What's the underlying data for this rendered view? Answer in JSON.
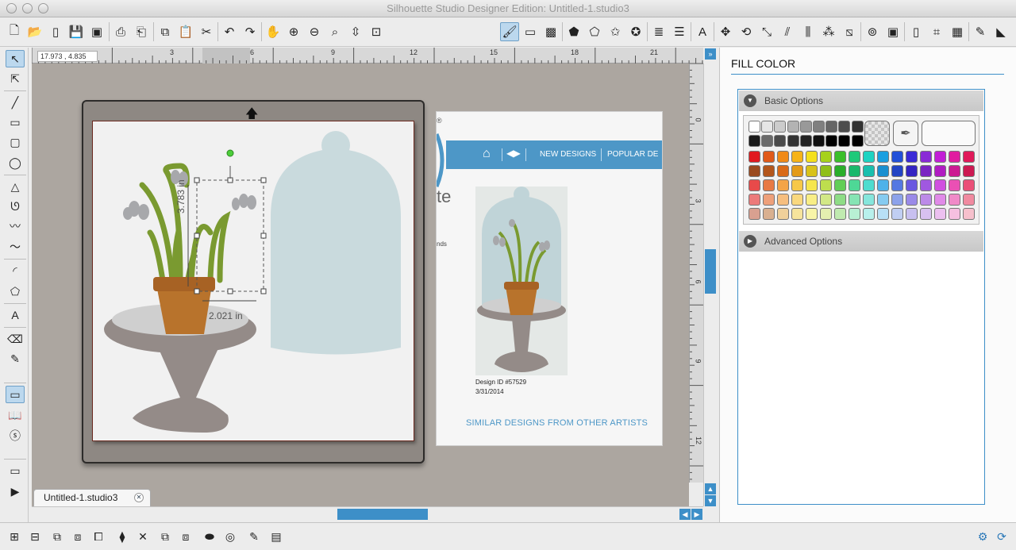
{
  "window": {
    "title": "Silhouette Studio Designer Edition: Untitled-1.studio3"
  },
  "ruler": {
    "coordinates": "17.973 , 4.835",
    "h_numbers": [
      "3",
      "6",
      "9",
      "12",
      "15",
      "18",
      "21"
    ],
    "v_numbers": [
      "0",
      "3",
      "6",
      "9",
      "12"
    ]
  },
  "canvas": {
    "dimensions": {
      "height": "3.783 in",
      "width": "2.021 in"
    }
  },
  "web_preview": {
    "reg_mark": "®",
    "title_fragment": "te",
    "fragment2": "nds",
    "nav_links": [
      "NEW DESIGNS",
      "POPULAR DE"
    ],
    "design_id": "Design ID #57529",
    "date": "3/31/2014",
    "similar": "SIMILAR DESIGNS FROM OTHER ARTISTS"
  },
  "doc_tab": {
    "name": "Untitled-1.studio3"
  },
  "panel": {
    "title": "FILL COLOR",
    "basic_options": "Basic Options",
    "advanced_options": "Advanced Options",
    "gray_row1": [
      "#ffffff",
      "#e6e6e6",
      "#cccccc",
      "#b3b3b3",
      "#999999",
      "#808080",
      "#666666",
      "#4d4d4d",
      "#333333"
    ],
    "gray_row2": [
      "#1a1a1a",
      "#6b6b6b",
      "#4a4a4a",
      "#333333",
      "#222222",
      "#111111",
      "#000000",
      "#000000",
      "#000000"
    ],
    "color_rows": [
      [
        "#e0191e",
        "#e05a1a",
        "#f08a18",
        "#f6b318",
        "#f4e01c",
        "#a6d21c",
        "#3bbf2a",
        "#1fc97a",
        "#1fd3c2",
        "#1a9fe0",
        "#2250d8",
        "#3a2ad6",
        "#8a2ad6",
        "#c21ed6",
        "#e01ca0",
        "#e01a5a"
      ],
      [
        "#9a4a1e",
        "#b3561c",
        "#d96a18",
        "#e39a18",
        "#d8c21a",
        "#8fbf1a",
        "#2aae2a",
        "#1ab86c",
        "#1abfae",
        "#1a8fd0",
        "#2244c4",
        "#3424c2",
        "#7a24c2",
        "#b01cc2",
        "#cc1a92",
        "#cc1a52"
      ],
      [
        "#e84a4a",
        "#e87a44",
        "#f4a448",
        "#f7c848",
        "#f6e64e",
        "#bede4e",
        "#62ce56",
        "#4ed896",
        "#4edccf",
        "#4eb2ea",
        "#5478e2",
        "#6a58e0",
        "#a058e0",
        "#d050e0",
        "#ea50b4",
        "#ea5078"
      ],
      [
        "#ec7a7a",
        "#eea07a",
        "#f6be7e",
        "#f9d87e",
        "#f8ee86",
        "#d2e886",
        "#8edc86",
        "#86e4b4",
        "#86e6dc",
        "#86cbf0",
        "#8ca2ea",
        "#9a8ae8",
        "#bc8ae8",
        "#e08ae8",
        "#f08ac8",
        "#f08aa0"
      ],
      [
        "#d9a090",
        "#d9b090",
        "#f0d09a",
        "#f6e49c",
        "#f8f4a8",
        "#e4f0b0",
        "#c0eab0",
        "#b8f0d4",
        "#b8f0ec",
        "#b8e0f6",
        "#c0cef2",
        "#c8c0f0",
        "#d8c0f0",
        "#ecc0f0",
        "#f6c0e0",
        "#f6c0cc"
      ]
    ]
  },
  "colors": {
    "accent": "#3d8fc8",
    "mat": "#8e8883",
    "canvas_bg": "#aca6a0",
    "web_nav": "#4d97c7"
  }
}
